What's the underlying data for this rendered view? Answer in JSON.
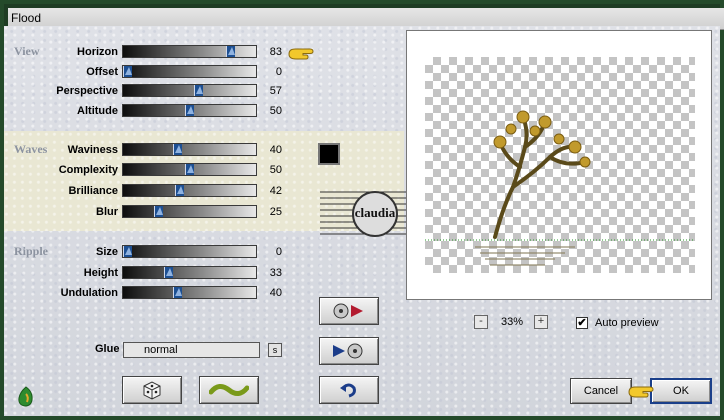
{
  "window": {
    "title": "Flood"
  },
  "sections": {
    "view": "View",
    "waves": "Waves",
    "ripple": "Ripple"
  },
  "controls": [
    {
      "id": "horizon",
      "label": "Horizon",
      "value": 83,
      "max": 100
    },
    {
      "id": "offset",
      "label": "Offset",
      "value": 0,
      "max": 100
    },
    {
      "id": "perspective",
      "label": "Perspective",
      "value": 57,
      "max": 100
    },
    {
      "id": "altitude",
      "label": "Altitude",
      "value": 50,
      "max": 100
    },
    {
      "id": "waviness",
      "label": "Waviness",
      "value": 40,
      "max": 100
    },
    {
      "id": "complexity",
      "label": "Complexity",
      "value": 50,
      "max": 100
    },
    {
      "id": "brilliance",
      "label": "Brilliance",
      "value": 42,
      "max": 100
    },
    {
      "id": "blur",
      "label": "Blur",
      "value": 25,
      "max": 100
    },
    {
      "id": "size",
      "label": "Size",
      "value": 0,
      "max": 100
    },
    {
      "id": "height",
      "label": "Height",
      "value": 33,
      "max": 100
    },
    {
      "id": "undulation",
      "label": "Undulation",
      "value": 40,
      "max": 100
    }
  ],
  "color_swatch": "#000000",
  "watermark": {
    "text": "claudia"
  },
  "glue": {
    "label": "Glue",
    "value": "normal",
    "s_button": "s"
  },
  "zoom": {
    "minus": "-",
    "value": "33%",
    "plus": "+"
  },
  "auto_preview": {
    "label": "Auto preview",
    "checked": true,
    "mark": "✔"
  },
  "buttons": {
    "cancel": "Cancel",
    "ok": "OK"
  },
  "icons": {
    "load-preset": "disc-arrow-right-icon",
    "save-preset": "arrow-right-disc-icon",
    "reset": "undo-arrow-icon",
    "random": "dice-icon",
    "wave": "wave-icon",
    "logo": "flaming-pear-logo-icon",
    "pointer": "pointing-hand-icon"
  },
  "colors": {
    "frame": "#244a2a",
    "slider_thumb": "#1d4f92",
    "section_label": "#8c93a0",
    "waves_band": "#e9e7d3"
  }
}
